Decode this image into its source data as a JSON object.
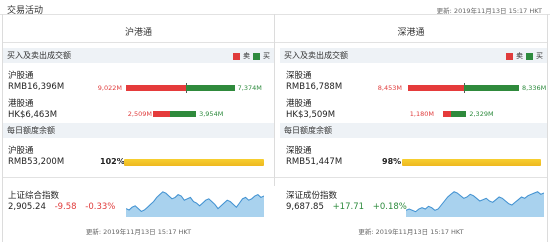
{
  "header": {
    "title": "交易活动",
    "update_time": "更新: 2019年11月13日 15:17 HKT"
  },
  "left": {
    "title": "沪港通",
    "flow_label": "买入及卖出成交额",
    "legend_sell": "卖",
    "legend_buy": "买",
    "north": {
      "name": "沪股通",
      "total": "RMB16,396M",
      "sell": "9,022M",
      "buy": "7,374M",
      "sell_value": 9022,
      "buy_value": 7374
    },
    "south": {
      "name": "港股通",
      "total": "HK$6,463M",
      "sell": "2,509M",
      "buy": "3,954M",
      "sell_value": 2509,
      "buy_value": 3954
    },
    "quota_label": "每日额度余额",
    "quota_name": "沪股通",
    "quota_value": "RMB53,200M",
    "quota_pct": "102%",
    "quota_fraction": 1.02,
    "index": {
      "name": "上证综合指数",
      "price": "2,905.24",
      "change": "-9.58",
      "pct": "-0.33%"
    },
    "update_time": "更新: 2019年11月13日 15:17 HKT"
  },
  "right": {
    "title": "深港通",
    "flow_label": "买入及卖出成交额",
    "legend_sell": "卖",
    "legend_buy": "买",
    "north": {
      "name": "深股通",
      "total": "RMB16,788M",
      "sell": "8,453M",
      "buy": "8,336M",
      "sell_value": 8453,
      "buy_value": 8336
    },
    "south": {
      "name": "港股通",
      "total": "HK$3,509M",
      "sell": "1,180M",
      "buy": "2,329M",
      "sell_value": 1180,
      "buy_value": 2329
    },
    "quota_label": "每日额度余额",
    "quota_name": "深股通",
    "quota_value": "RMB51,447M",
    "quota_pct": "98%",
    "quota_fraction": 0.98,
    "index": {
      "name": "深证成份指数",
      "price": "9,687.85",
      "change": "+17.71",
      "pct": "+0.18%"
    },
    "update_time": "更新: 2019年11月13日 15:17 HKT"
  },
  "colors": {
    "sell": "#e53b3b",
    "buy": "#2f8a3c",
    "quota": "#f2c12a",
    "spark_fill": "#a9d2ee",
    "spark_line": "#3d8fd0"
  },
  "left_spark": [
    48,
    47,
    49,
    50,
    48,
    46,
    47,
    49,
    51,
    53,
    56,
    58,
    60,
    59,
    57,
    55,
    56,
    58,
    57,
    54,
    55,
    56,
    53,
    52,
    50,
    52,
    54,
    55,
    53,
    51,
    48,
    50,
    52,
    54,
    53,
    51,
    49,
    52,
    55,
    56,
    54,
    55,
    57,
    58,
    56,
    57
  ],
  "right_spark": [
    46,
    47,
    46,
    45,
    47,
    48,
    47,
    49,
    48,
    46,
    47,
    50,
    53,
    56,
    58,
    60,
    59,
    57,
    55,
    56,
    58,
    57,
    55,
    53,
    54,
    55,
    53,
    52,
    54,
    56,
    55,
    53,
    51,
    50,
    52,
    54,
    56,
    55,
    57,
    58,
    59,
    60,
    58,
    59
  ]
}
